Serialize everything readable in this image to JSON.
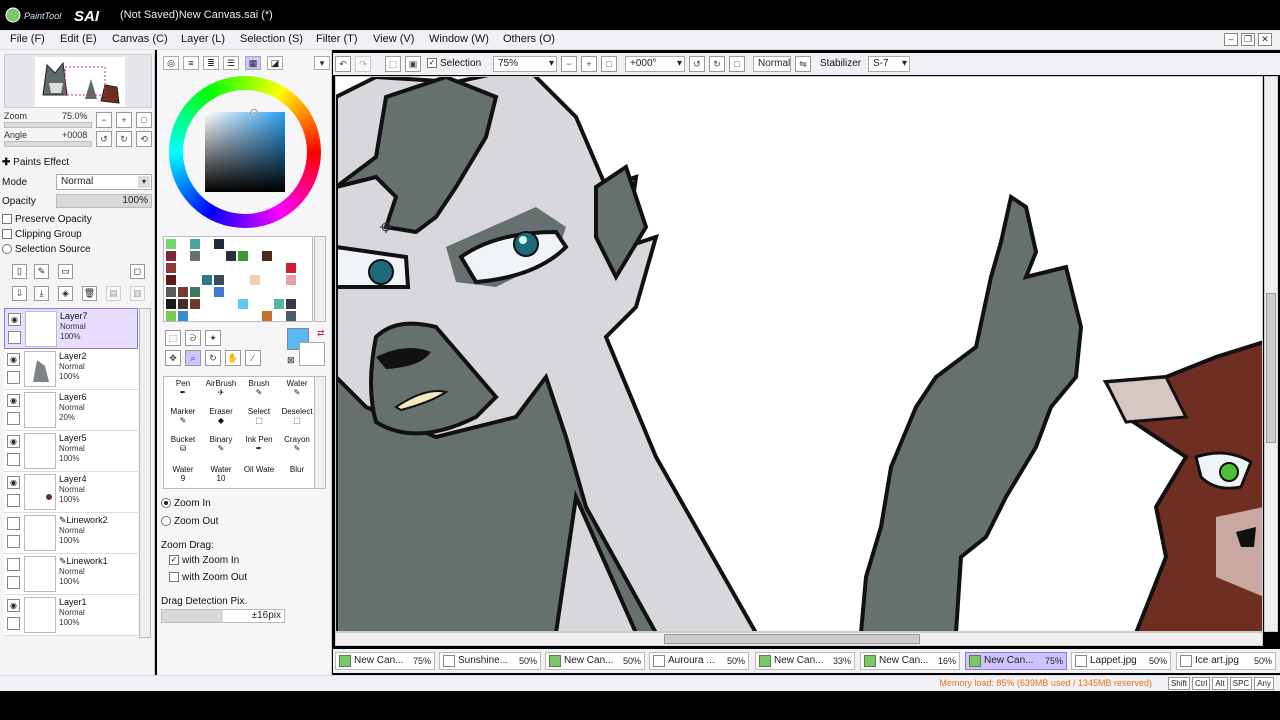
{
  "window": {
    "title": "(Not Saved)New Canvas.sai (*)",
    "logo_text": "PaintTool SAI"
  },
  "menu": [
    "File (F)",
    "Edit (E)",
    "Canvas (C)",
    "Layer (L)",
    "Selection (S)",
    "Filter (T)",
    "View (V)",
    "Window (W)",
    "Others (O)"
  ],
  "navigator": {
    "zoom_label": "Zoom",
    "zoom_value": "75.0%",
    "angle_label": "Angle",
    "angle_value": "+0008"
  },
  "paints_effect": {
    "title": "Paints Effect",
    "mode_label": "Mode",
    "mode_value": "Normal",
    "opacity_label": "Opacity",
    "opacity_value": "100%",
    "opacity_fill": 1.0
  },
  "layer_options": {
    "preserve_opacity": "Preserve Opacity",
    "clipping_group": "Clipping Group",
    "selection_source": "Selection Source"
  },
  "layers": [
    {
      "name": "Layer7",
      "mode": "Normal",
      "opacity": "100%",
      "selected": true,
      "visible": true
    },
    {
      "name": "Layer2",
      "mode": "Normal",
      "opacity": "100%",
      "selected": false,
      "visible": true
    },
    {
      "name": "Layer6",
      "mode": "Normal",
      "opacity": "20%",
      "selected": false,
      "visible": true
    },
    {
      "name": "Layer5",
      "mode": "Normal",
      "opacity": "100%",
      "selected": false,
      "visible": true
    },
    {
      "name": "Layer4",
      "mode": "Normal",
      "opacity": "100%",
      "selected": false,
      "visible": true
    },
    {
      "name": "Linework2",
      "mode": "Normal",
      "opacity": "100%",
      "selected": false,
      "visible": false
    },
    {
      "name": "Linework1",
      "mode": "Normal",
      "opacity": "100%",
      "selected": false,
      "visible": false
    },
    {
      "name": "Layer1",
      "mode": "Normal",
      "opacity": "100%",
      "selected": false,
      "visible": true
    }
  ],
  "colors": {
    "primary": "#5cb8f5",
    "accent": "#cfc4ff",
    "memory_text": "#e0761a"
  },
  "tools": [
    {
      "label": "Pen"
    },
    {
      "label": "AirBrush"
    },
    {
      "label": "Brush"
    },
    {
      "label": "Water"
    },
    {
      "label": "Marker"
    },
    {
      "label": "Eraser"
    },
    {
      "label": "Select"
    },
    {
      "label": "Deselect"
    },
    {
      "label": "Bucket"
    },
    {
      "label": "Binary"
    },
    {
      "label": "Ink Pen"
    },
    {
      "label": "Crayon"
    },
    {
      "label": "Water"
    },
    {
      "label": "Water"
    },
    {
      "label": "Oil Wate"
    },
    {
      "label": "Blur"
    }
  ],
  "tool_sub": [
    "9",
    "10"
  ],
  "zoom_options": {
    "zoom_in": "Zoom In",
    "zoom_out": "Zoom Out",
    "zoom_drag": "Zoom Drag:",
    "with_zoom_in": "with Zoom In",
    "with_zoom_out": "with Zoom Out",
    "drag_detection": "Drag Detection Pix.",
    "drag_value": "±16pix"
  },
  "toolbar": {
    "selection_label": "Selection",
    "zoom_value": "75%",
    "angle_value": "+000°",
    "blend_mode": "Normal",
    "stabilizer_label": "Stabilizer",
    "stabilizer_value": "S-7"
  },
  "doc_tabs": [
    {
      "name": "New Can...",
      "zoom": "75%",
      "selected": false
    },
    {
      "name": "Sunshine...",
      "zoom": "50%",
      "selected": false
    },
    {
      "name": "New Can...",
      "zoom": "50%",
      "selected": false
    },
    {
      "name": "Auroura ...",
      "zoom": "50%",
      "selected": false
    },
    {
      "name": "New Can...",
      "zoom": "33%",
      "selected": false
    },
    {
      "name": "New Can...",
      "zoom": "16%",
      "selected": false
    },
    {
      "name": "New Can...",
      "zoom": "75%",
      "selected": true
    },
    {
      "name": "Lappet.jpg",
      "zoom": "50%",
      "selected": false
    },
    {
      "name": "Ice art.jpg",
      "zoom": "50%",
      "selected": false
    }
  ],
  "status": {
    "memory": "Memory load: 85% (639MB used / 1345MB reserved)",
    "keys": [
      "Shift",
      "Ctrl",
      "Alt",
      "SPC",
      "Any"
    ]
  }
}
